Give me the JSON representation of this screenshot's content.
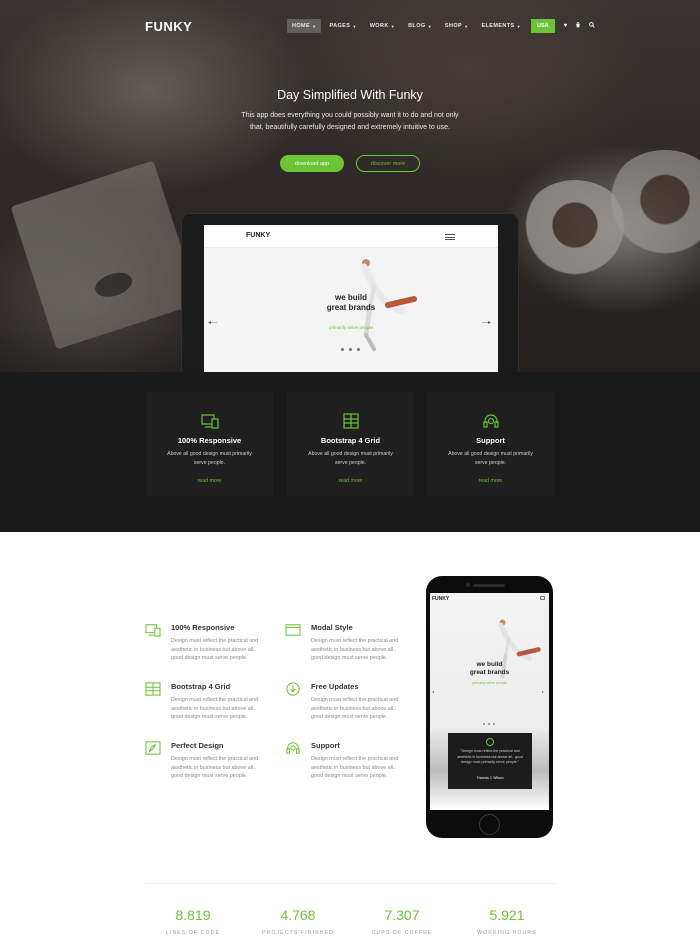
{
  "brand": {
    "logo": "FUNKY",
    "accent": "#6cc437"
  },
  "nav": {
    "items": [
      {
        "label": "HOME",
        "active": true
      },
      {
        "label": "PAGES"
      },
      {
        "label": "WORK"
      },
      {
        "label": "BLOG"
      },
      {
        "label": "SHOP"
      },
      {
        "label": "ELEMENTS"
      }
    ],
    "cta": "USA",
    "icons": [
      "heart-icon",
      "cart-icon",
      "search-icon"
    ]
  },
  "hero": {
    "title": "Day Simplified With Funky",
    "subtitle_line1": "This app does everything you could possibly want it to do and not only",
    "subtitle_line2": "that, beautifully carefully designed and extremely intuitive to use.",
    "primary_button": "download app",
    "secondary_button": "discover more"
  },
  "tablet_screen": {
    "logo": "FUNKY",
    "headline_line1": "we build",
    "headline_line2": "great brands",
    "subline": "primarily serve people"
  },
  "dark_features": [
    {
      "icon": "devices-icon",
      "title": "100% Responsive",
      "desc_line1": "Above all good design must primarily",
      "desc_line2": "serve people.",
      "link": "read more"
    },
    {
      "icon": "grid-icon",
      "title": "Bootstrap 4 Grid",
      "desc_line1": "Above all good design must primarily",
      "desc_line2": "serve people.",
      "link": "read more"
    },
    {
      "icon": "headset-icon",
      "title": "Support",
      "desc_line1": "Above all good design must primarily",
      "desc_line2": "serve people.",
      "link": "read more"
    }
  ],
  "white_features": [
    {
      "icon": "devices-icon",
      "title": "100% Responsive",
      "l1": "Design must reflect the practical and",
      "l2": "aesthetic in business but above all..",
      "l3": "good design must serve people."
    },
    {
      "icon": "modal-icon",
      "title": "Modal Style",
      "l1": "Design must reflect the practical and",
      "l2": "aesthetic in business but above all..",
      "l3": "good design must serve people."
    },
    {
      "icon": "grid-icon",
      "title": "Bootstrap 4 Grid",
      "l1": "Design must reflect the practical and",
      "l2": "aesthetic in business but above all..",
      "l3": "good design must serve people."
    },
    {
      "icon": "download-icon",
      "title": "Free Updates",
      "l1": "Design must reflect the practical and",
      "l2": "aesthetic in business but above all..",
      "l3": "good design must serve people."
    },
    {
      "icon": "pen-icon",
      "title": "Perfect Design",
      "l1": "Design must reflect the practical and",
      "l2": "aesthetic in business but above all..",
      "l3": "good design must serve people."
    },
    {
      "icon": "headset-icon",
      "title": "Support",
      "l1": "Design must reflect the practical and",
      "l2": "aesthetic in business but above all..",
      "l3": "good design must serve people."
    }
  ],
  "phone_screen": {
    "logo": "FUNKY",
    "headline_line1": "we build",
    "headline_line2": "great brands",
    "subline": "primarily serve people",
    "quote": "\"Design must reflect the practical and aesthetic in business but above all.. good design must primarily serve people.\"",
    "quote_author": "Thomas J. Wilson"
  },
  "stats": [
    {
      "value": "8.819",
      "label": "LINES OF CODE"
    },
    {
      "value": "4.768",
      "label": "PROJECTS FINISHED"
    },
    {
      "value": "7.307",
      "label": "CUPS OF COFFEE"
    },
    {
      "value": "5.921",
      "label": "WORKING HOURS"
    }
  ]
}
